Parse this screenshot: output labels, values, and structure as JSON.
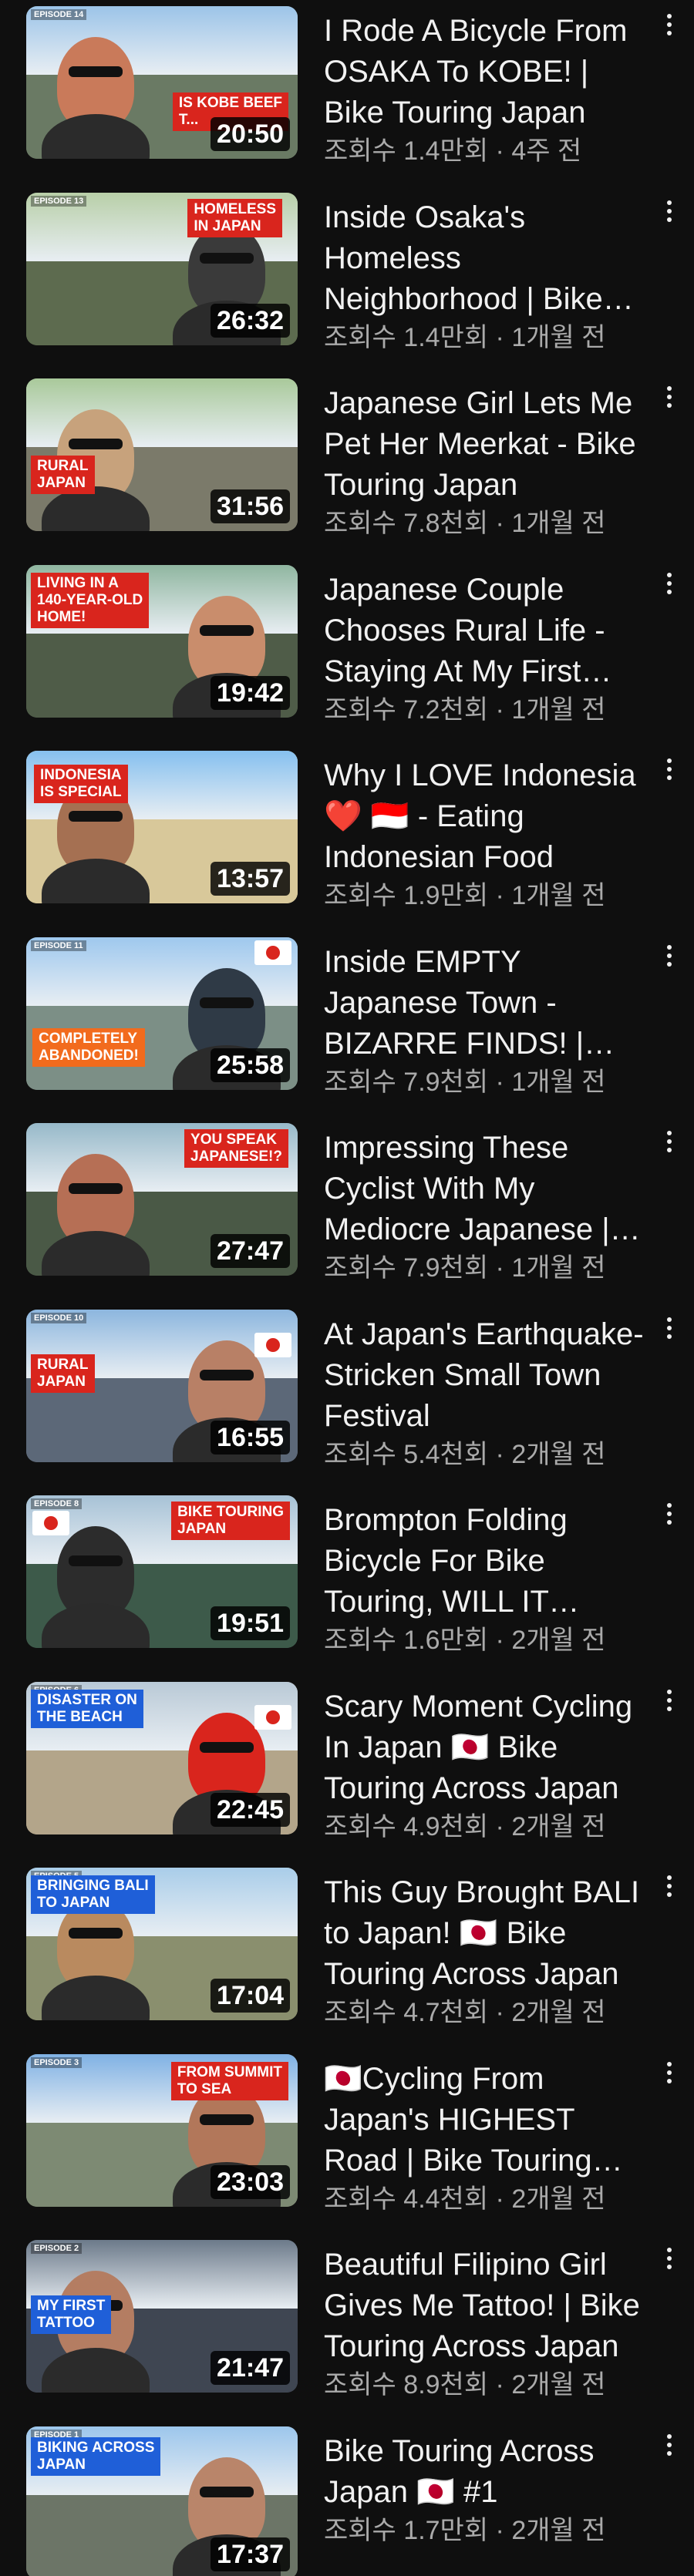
{
  "videos": [
    {
      "title": "I Rode A Bicycle From OSAKA To KOBE!  | Bike Touring Japan",
      "meta": "조회수 1.4만회 · 4주 전",
      "duration": "20:50",
      "badge": "IS KOBE BEEF\nT...",
      "episode": "EPISODE 14",
      "palette": {
        "sky": "#9cc4e8",
        "ground": "#6a7a64",
        "person": "#c97a5a"
      }
    },
    {
      "title": "Inside Osaka's Homeless Neighborhood | Bike Touring Japan",
      "meta": "조회수 1.4만회 · 1개월 전",
      "duration": "26:32",
      "badge": "HOMELESS\nIN JAPAN",
      "episode": "EPISODE 13",
      "palette": {
        "sky": "#b8cfa8",
        "ground": "#5d6b4f",
        "person": "#3a3a3a"
      }
    },
    {
      "title": "Japanese Girl Lets Me Pet Her Meerkat - Bike Touring Japan",
      "meta": "조회수 7.8천회 · 1개월 전",
      "duration": "31:56",
      "badge": "RURAL\nJAPAN",
      "episode": "",
      "palette": {
        "sky": "#a9c99a",
        "ground": "#7b7a6a",
        "person": "#c7a27c"
      }
    },
    {
      "title": "Japanese Couple Chooses Rural Life - Staying At My First Japanese Home",
      "meta": "조회수 7.2천회 · 1개월 전",
      "duration": "19:42",
      "badge": "LIVING IN A\n140-YEAR-OLD\nHOME!",
      "episode": "",
      "palette": {
        "sky": "#8fb6a0",
        "ground": "#4f5c48",
        "person": "#c98d6c"
      }
    },
    {
      "title": "Why I LOVE Indonesia ❤️ 🇮🇩 - Eating Indonesian Food",
      "meta": "조회수 1.9만회 · 1개월 전",
      "duration": "13:57",
      "badge": "INDONESIA\nIS SPECIAL",
      "episode": "",
      "palette": {
        "sky": "#86c0ef",
        "ground": "#d8c89a",
        "person": "#a57052"
      }
    },
    {
      "title": "Inside EMPTY Japanese Town - BIZARRE FINDS! | Bike Touring Japan",
      "meta": "조회수 7.9천회 · 1개월 전",
      "duration": "25:58",
      "badge": "COMPLETELY\nABANDONED!",
      "badge_style": "orange",
      "episode": "EPISODE 11",
      "flag": true,
      "palette": {
        "sky": "#9ec8ee",
        "ground": "#7c8f86",
        "person": "#2f3a46"
      }
    },
    {
      "title": "Impressing These Cyclist With My Mediocre Japanese | Bike Touring Japan",
      "meta": "조회수 7.9천회 · 1개월 전",
      "duration": "27:47",
      "badge": "YOU SPEAK\nJAPANESE!?",
      "episode": "",
      "palette": {
        "sky": "#97b9c9",
        "ground": "#4a5946",
        "person": "#b66f55"
      }
    },
    {
      "title": "At Japan's Earthquake-Stricken Small Town Festival",
      "meta": "조회수 5.4천회 · 2개월 전",
      "duration": "16:55",
      "badge": "RURAL\nJAPAN",
      "episode": "EPISODE 10",
      "flag": true,
      "palette": {
        "sky": "#8cb6de",
        "ground": "#5c6878",
        "person": "#b88066"
      }
    },
    {
      "title": "Brompton Folding Bicycle For Bike Touring, WILL IT WORK?",
      "meta": "조회수 1.6만회 · 2개월 전",
      "duration": "19:51",
      "badge": "BIKE TOURING\nJAPAN",
      "episode": "EPISODE 8",
      "flag": true,
      "palette": {
        "sky": "#a7c2d6",
        "ground": "#3d5a4a",
        "person": "#2c2c2c"
      }
    },
    {
      "title": "Scary Moment Cycling In Japan 🇯🇵 Bike Touring Across Japan",
      "meta": "조회수 4.9천회 · 2개월 전",
      "duration": "22:45",
      "badge": "DISASTER ON\nTHE BEACH",
      "badge_style": "blue",
      "episode": "EPISODE 6",
      "flag": true,
      "palette": {
        "sky": "#b9c9d6",
        "ground": "#b3a58a",
        "person": "#d9251d"
      }
    },
    {
      "title": "This Guy Brought BALI to Japan! 🇯🇵 Bike Touring Across Japan",
      "meta": "조회수 4.7천회 · 2개월 전",
      "duration": "17:04",
      "badge": "BRINGING BALI\nTO JAPAN",
      "badge_style": "blue",
      "episode": "EPISODE 5",
      "palette": {
        "sky": "#a9cde9",
        "ground": "#8a8f6e",
        "person": "#b98a5f"
      }
    },
    {
      "title": "🇯🇵Cycling From Japan's HIGHEST Road | Bike Touring Japan",
      "meta": "조회수 4.4천회 · 2개월 전",
      "duration": "23:03",
      "badge": "FROM SUMMIT\nTO SEA",
      "episode": "EPISODE 3",
      "palette": {
        "sky": "#7fb1e4",
        "ground": "#7d8a73",
        "person": "#b2775a"
      }
    },
    {
      "title": "Beautiful Filipino Girl Gives Me Tattoo!  | Bike Touring Across Japan",
      "meta": "조회수 8.9천회 · 2개월 전",
      "duration": "21:47",
      "badge": "MY FIRST\nTATTOO",
      "badge_style": "blue",
      "episode": "EPISODE 2",
      "palette": {
        "sky": "#6c7a8a",
        "ground": "#3f4652",
        "person": "#b47d62"
      }
    },
    {
      "title": "Bike Touring Across Japan 🇯🇵  #1",
      "meta": "조회수 1.7만회 · 2개월 전",
      "duration": "17:37",
      "badge": "BIKING ACROSS\nJAPAN",
      "badge_style": "blue",
      "episode": "EPISODE 1",
      "short": true,
      "palette": {
        "sky": "#9cc6ec",
        "ground": "#6c7567",
        "person": "#b9856a"
      }
    }
  ]
}
